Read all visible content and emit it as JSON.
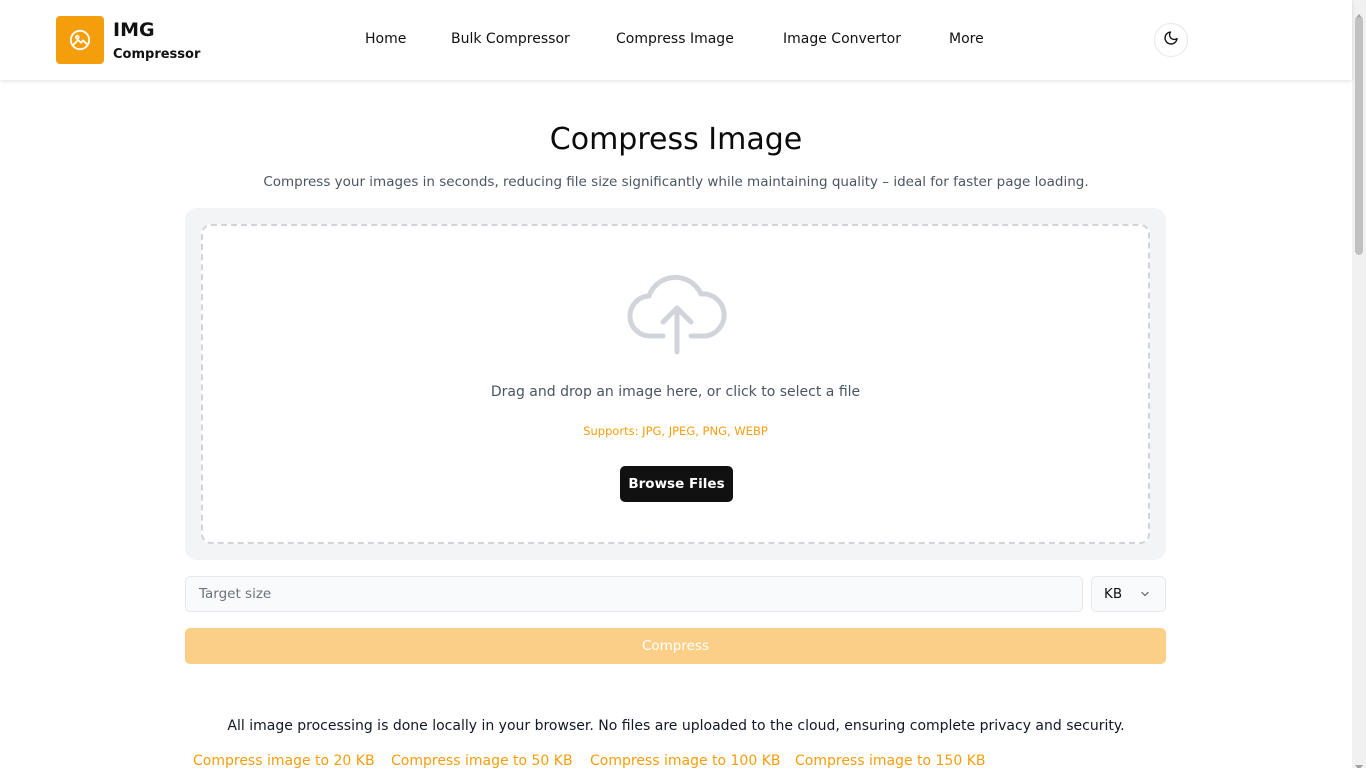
{
  "brand": {
    "title": "IMG",
    "subtitle": "Compressor",
    "accent_color": "#f59e0b",
    "logo_icon": "image-icon"
  },
  "nav": {
    "items": [
      {
        "label": "Home"
      },
      {
        "label": "Bulk Compressor"
      },
      {
        "label": "Compress Image"
      },
      {
        "label": "Image Convertor"
      },
      {
        "label": "More"
      }
    ],
    "theme_icon": "moon-icon"
  },
  "main": {
    "title": "Compress Image",
    "subtitle": "Compress your images in seconds, reducing file size significantly while maintaining quality – ideal for faster page loading.",
    "dropzone": {
      "icon": "cloud-upload-icon",
      "text": "Drag and drop an image here, or click to select a file",
      "supports": "Supports: JPG, JPEG, PNG, WEBP",
      "browse_label": "Browse Files"
    },
    "target": {
      "placeholder": "Target size",
      "value": "",
      "unit": "KB"
    },
    "compress_label": "Compress",
    "privacy_note": "All image processing is done locally in your browser. No files are uploaded to the cloud, ensuring complete privacy and security.",
    "quick_links": [
      {
        "label": "Compress image to 20 KB"
      },
      {
        "label": "Compress image to 50 KB"
      },
      {
        "label": "Compress image to 100 KB"
      },
      {
        "label": "Compress image to 150 KB"
      }
    ]
  }
}
